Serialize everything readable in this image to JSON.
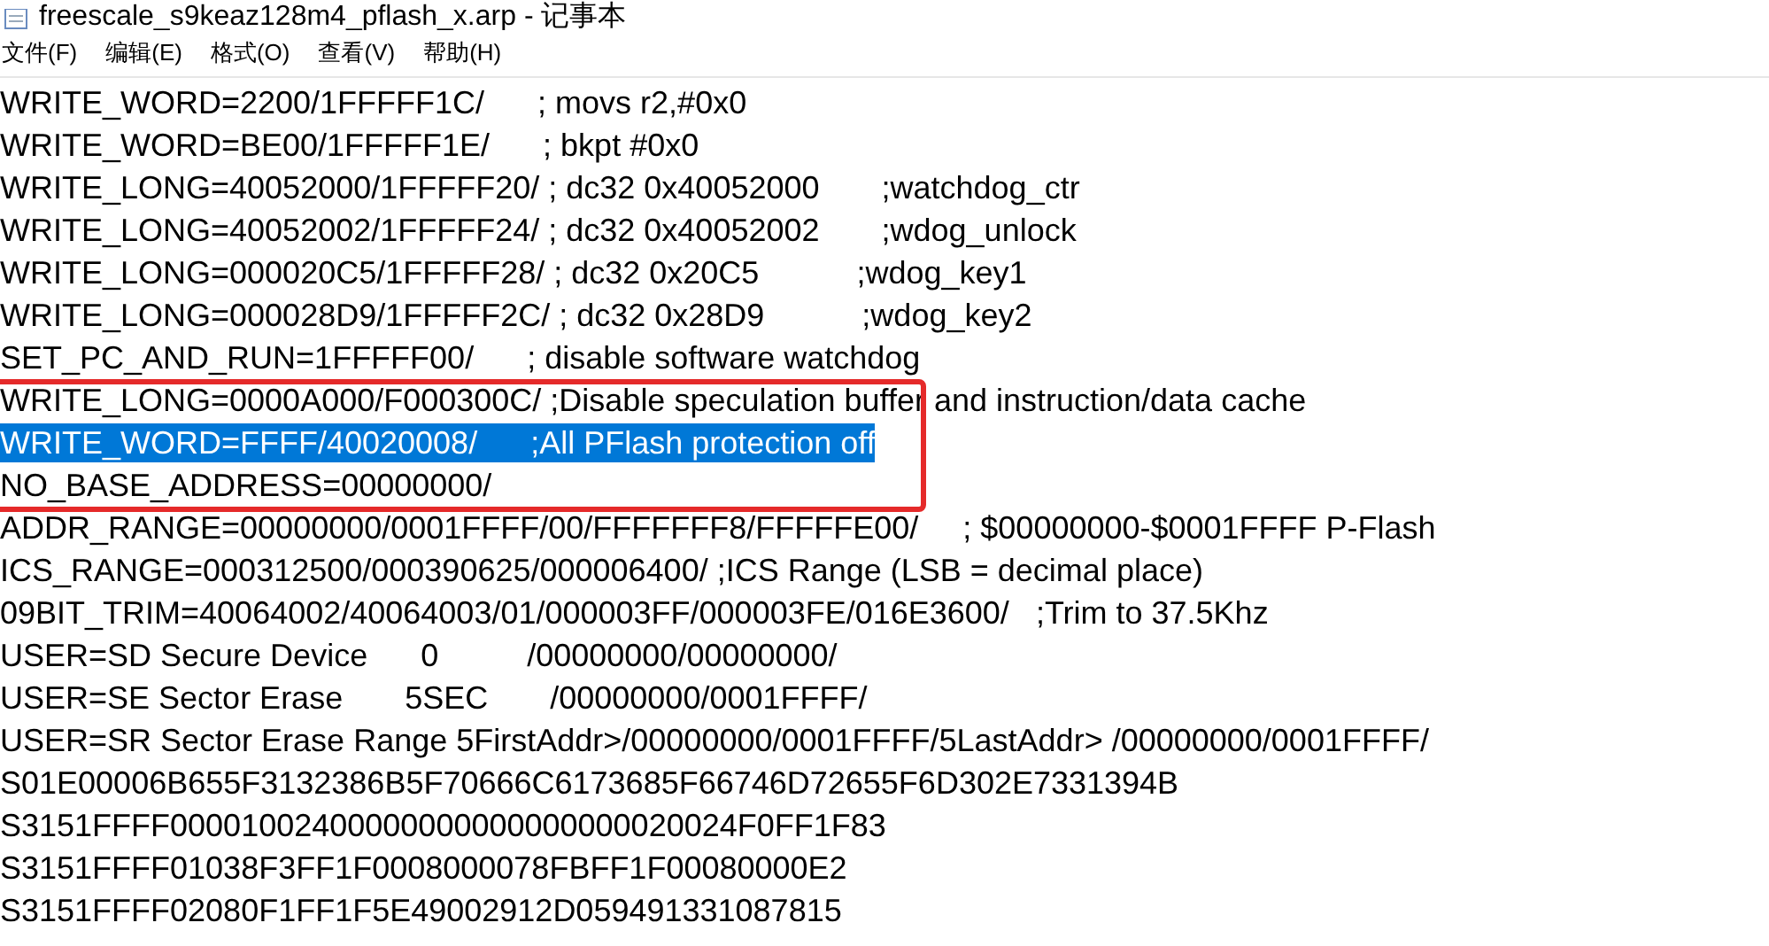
{
  "window": {
    "title": "freescale_s9keaz128m4_pflash_x.arp - 记事本"
  },
  "menu": [
    {
      "label": "文件(F)"
    },
    {
      "label": "编辑(E)"
    },
    {
      "label": "格式(O)"
    },
    {
      "label": "查看(V)"
    },
    {
      "label": "帮助(H)"
    }
  ],
  "lines": [
    {
      "text": "WRITE_WORD=2200/1FFFFF1C/      ; movs r2,#0x0",
      "selected": false
    },
    {
      "text": "WRITE_WORD=BE00/1FFFFF1E/      ; bkpt #0x0",
      "selected": false
    },
    {
      "text": "WRITE_LONG=40052000/1FFFFF20/ ; dc32 0x40052000       ;watchdog_ctr",
      "selected": false
    },
    {
      "text": "WRITE_LONG=40052002/1FFFFF24/ ; dc32 0x40052002       ;wdog_unlock",
      "selected": false
    },
    {
      "text": "WRITE_LONG=000020C5/1FFFFF28/ ; dc32 0x20C5           ;wdog_key1",
      "selected": false
    },
    {
      "text": "WRITE_LONG=000028D9/1FFFFF2C/ ; dc32 0x28D9           ;wdog_key2",
      "selected": false
    },
    {
      "text": "SET_PC_AND_RUN=1FFFFF00/      ; disable software watchdog",
      "selected": false
    },
    {
      "text": "WRITE_LONG=0000A000/F000300C/ ;Disable speculation buffer and instruction/data cache",
      "selected": false
    },
    {
      "text": "WRITE_WORD=FFFF/40020008/      ;All PFlash protection off",
      "selected": true
    },
    {
      "text": "NO_BASE_ADDRESS=00000000/",
      "selected": false
    },
    {
      "text": "ADDR_RANGE=00000000/0001FFFF/00/FFFFFFF8/FFFFFE00/     ; $00000000-$0001FFFF P-Flash",
      "selected": false
    },
    {
      "text": "ICS_RANGE=000312500/000390625/000006400/ ;ICS Range (LSB = decimal place)",
      "selected": false
    },
    {
      "text": "09BIT_TRIM=40064002/40064003/01/000003FF/000003FE/016E3600/   ;Trim to 37.5Khz",
      "selected": false
    },
    {
      "text": "USER=SD Secure Device      0          /00000000/00000000/",
      "selected": false
    },
    {
      "text": "USER=SE Sector Erase       5SEC       /00000000/0001FFFF/",
      "selected": false
    },
    {
      "text": "USER=SR Sector Erase Range 5FirstAddr>/00000000/0001FFFF/5LastAddr> /00000000/0001FFFF/",
      "selected": false
    },
    {
      "text": "S01E00006B655F3132386B5F70666C6173685F66746D72655F6D302E7331394B",
      "selected": false
    },
    {
      "text": "S3151FFFF00001002400000000000000000020024F0FF1F83",
      "selected": false
    },
    {
      "text": "S3151FFFF01038F3FF1F0008000078FBFF1F00080000E2",
      "selected": false
    },
    {
      "text": "S3151FFFF02080F1FF1F5E49002912D059491331087815",
      "selected": false
    }
  ]
}
